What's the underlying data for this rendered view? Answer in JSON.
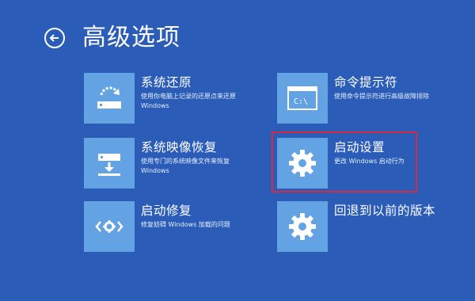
{
  "header": {
    "title": "高级选项"
  },
  "options": {
    "system_restore": {
      "title": "系统还原",
      "desc": "使用你电脑上记录的还原点来还原 Windows",
      "icon": "restore-icon"
    },
    "image_recovery": {
      "title": "系统映像恢复",
      "desc": "使用专门的系统映像文件来恢复 Windows",
      "icon": "image-recovery-icon"
    },
    "startup_repair": {
      "title": "启动修复",
      "desc": "修复妨碍 Windows 加载的问题",
      "icon": "startup-repair-icon"
    },
    "command_prompt": {
      "title": "命令提示符",
      "desc": "使用命令提示符进行高级故障排除",
      "icon_text": "C:\\",
      "icon": "command-prompt-icon"
    },
    "startup_settings": {
      "title": "启动设置",
      "desc": "更改 Windows 启动行为",
      "icon": "gear-icon"
    },
    "go_back": {
      "title": "回退到以前的版本",
      "desc": "",
      "icon": "gear-icon"
    }
  },
  "colors": {
    "background": "#2b5db8",
    "tile": "#63a2e3",
    "highlight": "#d62b3f"
  }
}
